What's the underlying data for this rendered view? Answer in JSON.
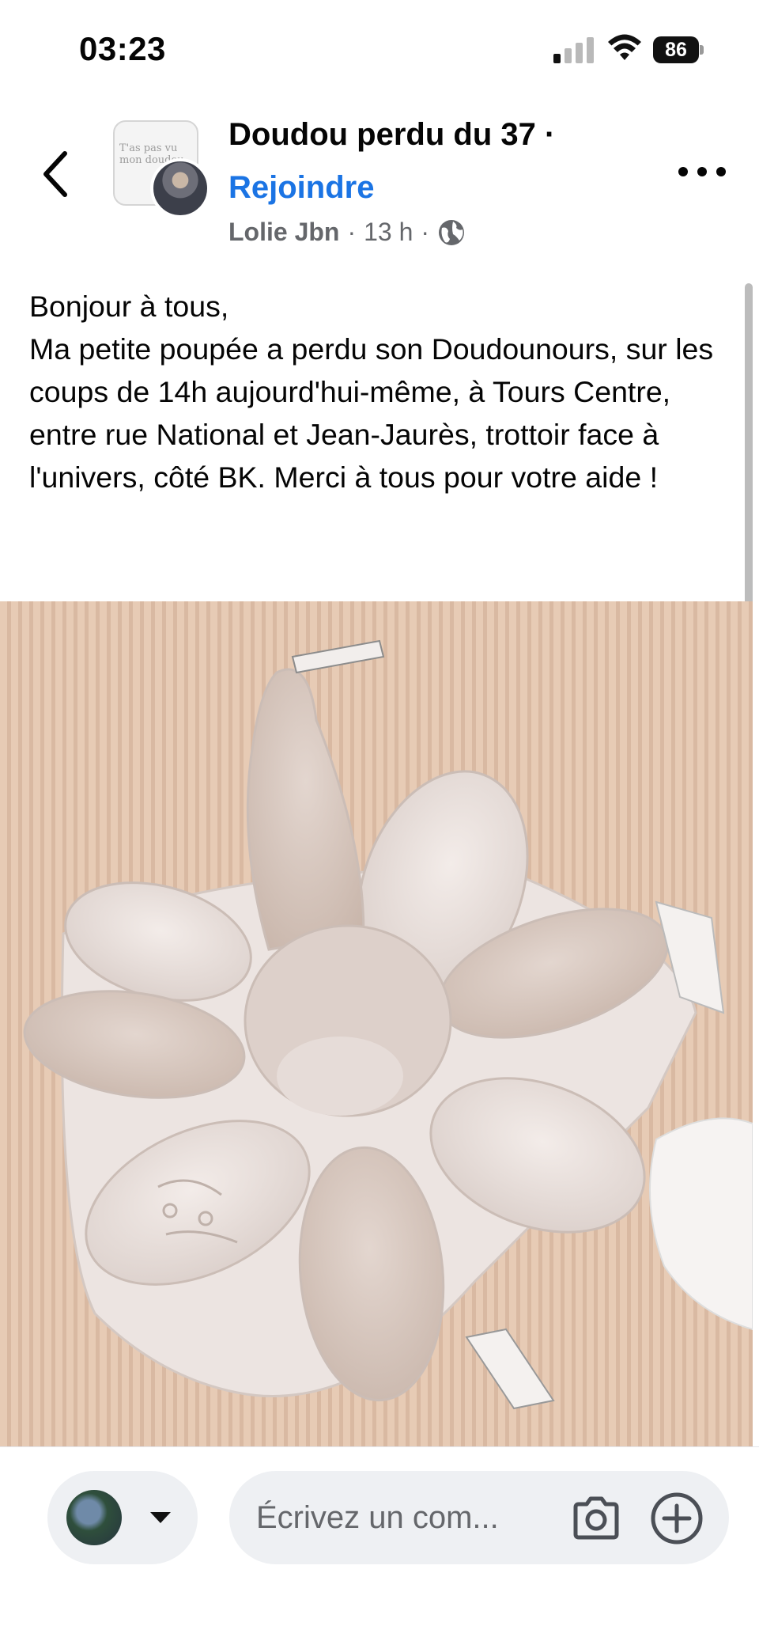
{
  "status_bar": {
    "time": "03:23",
    "battery_level": "86",
    "signal_bars_active": 1,
    "icons": [
      "signal-icon",
      "wifi-icon",
      "battery-icon"
    ]
  },
  "header": {
    "back_icon": "chevron-left-icon",
    "group_avatar_text": "T'as pas vu\nmon doudou",
    "group_name": "Doudou perdu du 37 ·",
    "join_label": "Rejoindre",
    "author": "Lolie Jbn",
    "separator": "·",
    "time_ago": "13 h",
    "privacy_icon": "globe-icon",
    "more_icon": "more-horizontal-icon"
  },
  "post": {
    "text": "Bonjour à tous,\nMa petite poupée a perdu son Doudounours, sur les coups de 14h aujourd'hui-même, à Tours Centre, entre rue National et Jean-Jaurès, trottoir face à l'univers, côté BK. Merci à tous pour votre aide !"
  },
  "comment_bar": {
    "placeholder": "Écrivez un com...",
    "camera_icon": "camera-icon",
    "add_icon": "plus-circle-icon",
    "caret_icon": "caret-down-icon"
  },
  "colors": {
    "link_blue": "#1b74e4",
    "meta_gray": "#65676b",
    "input_bg": "#eef0f3"
  }
}
